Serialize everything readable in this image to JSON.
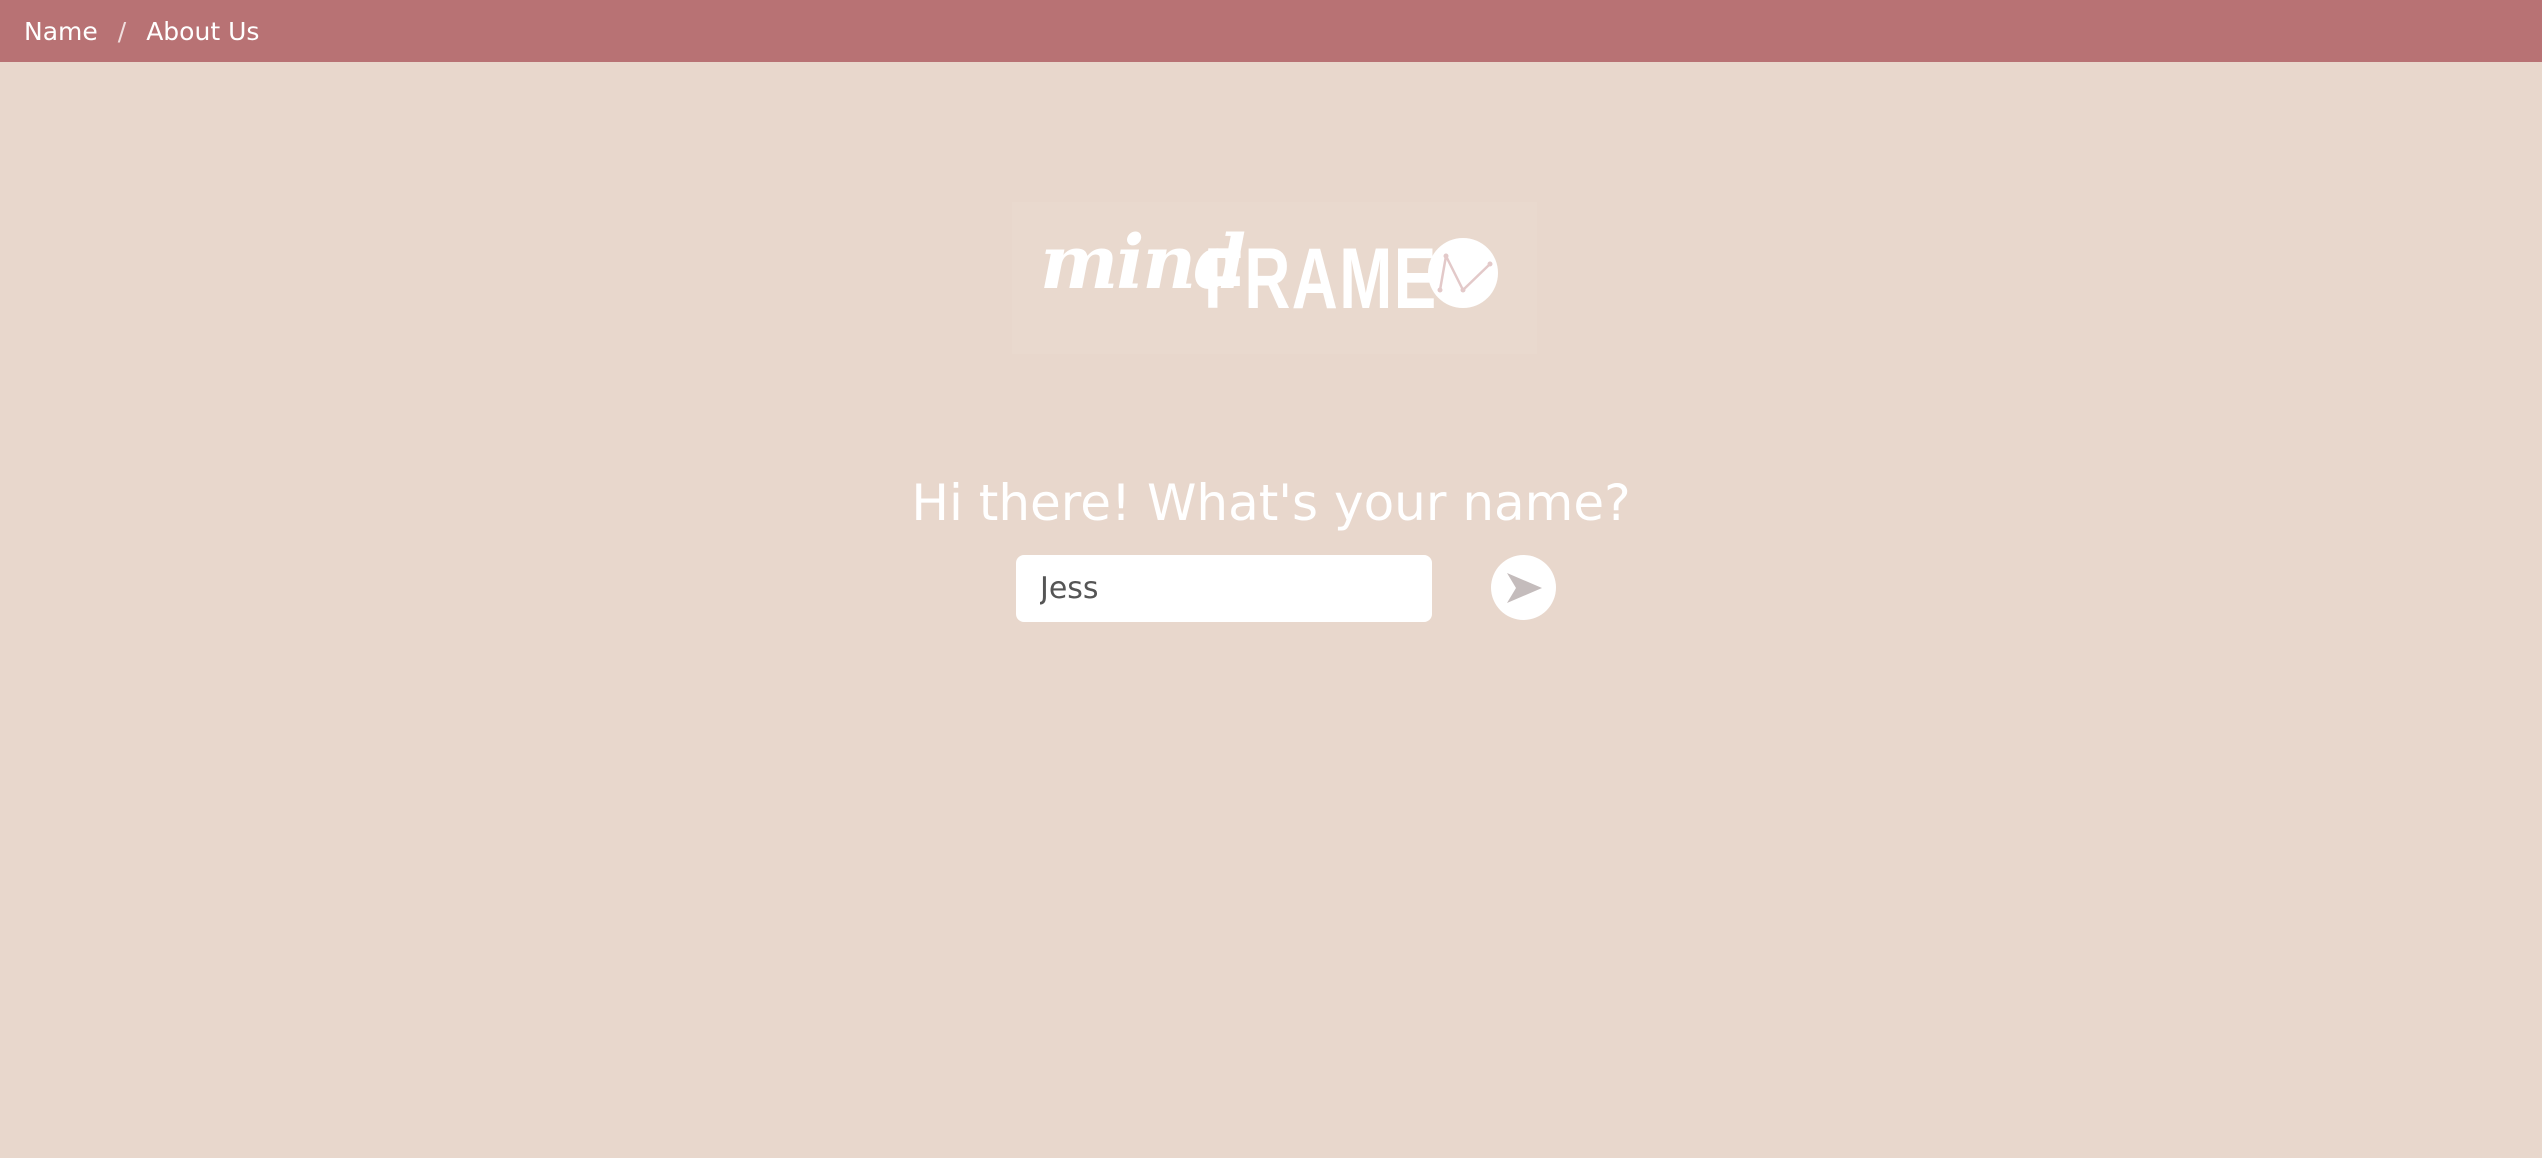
{
  "nav": {
    "breadcrumb": [
      "Name",
      "About Us"
    ],
    "separator": "/"
  },
  "logo": {
    "mind": "mind",
    "frame": "FRAME",
    "icon": "check-chart-icon"
  },
  "main": {
    "greeting": "Hi there! What's your name?",
    "name_value": "Jess",
    "submit_icon": "send-arrow-icon"
  },
  "colors": {
    "background": "#e8d7cc",
    "topbar": "#b87274",
    "text": "#ffffff",
    "icon_gray": "#c4bcbc"
  }
}
